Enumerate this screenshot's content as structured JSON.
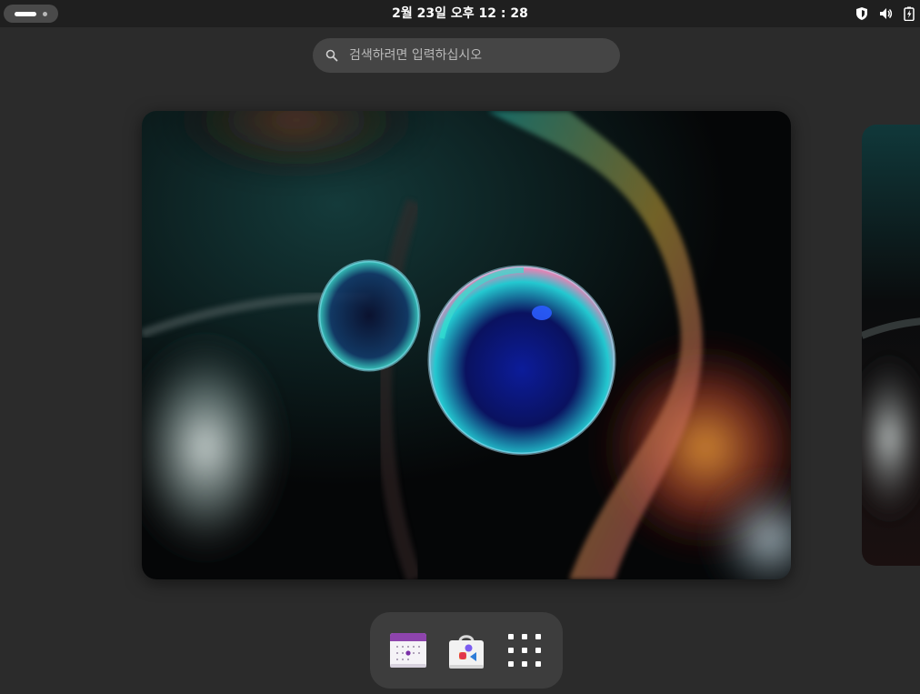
{
  "topbar": {
    "clock": "2월 23일  오후 12 : 28",
    "activities_icon": "activities-indicator",
    "status_icons": [
      "security-shield-icon",
      "volume-icon",
      "battery-icon"
    ]
  },
  "search": {
    "placeholder": "검색하려면 입력하십시오",
    "icon": "search-icon"
  },
  "workspaces": {
    "main_wallpaper": "bubbles-wallpaper",
    "next_wallpaper": "bubbles-wallpaper"
  },
  "dash": {
    "items": [
      {
        "icon": "calendar-app-icon"
      },
      {
        "icon": "software-store-icon"
      },
      {
        "icon": "show-apps-grid-icon"
      }
    ]
  },
  "colors": {
    "background": "#2b2b2b",
    "topbar": "#1f1f1f",
    "search_field": "#454545",
    "dash_bg": "#3d3d3d",
    "calendar_accent": "#8e44ad"
  }
}
